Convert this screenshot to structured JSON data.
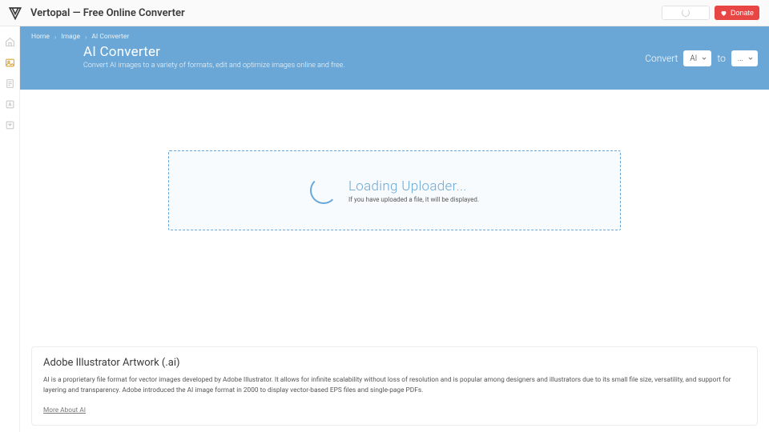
{
  "header": {
    "title": "Vertopal — Free Online Converter",
    "donate_label": "Donate"
  },
  "sidebar": {
    "items": [
      {
        "name": "home"
      },
      {
        "name": "image",
        "active": true
      },
      {
        "name": "document"
      },
      {
        "name": "font"
      },
      {
        "name": "ebook"
      }
    ]
  },
  "breadcrumb": {
    "items": [
      "Home",
      "Image",
      "AI Converter"
    ]
  },
  "hero": {
    "title": "AI Converter",
    "subtitle": "Convert AI images to a variety of formats, edit and optimize images online and free."
  },
  "convert_bar": {
    "label_convert": "Convert",
    "from_value": "AI",
    "label_to": "to",
    "to_value": "..."
  },
  "uploader": {
    "title": "Loading Uploader...",
    "subtitle": "If you have uploaded a file, it will be displayed."
  },
  "info": {
    "heading": "Adobe Illustrator Artwork (.ai)",
    "body": "AI is a proprietary file format for vector images developed by Adobe Illustrator. It allows for infinite scalability without loss of resolution and is popular among designers and illustrators due to its small file size, versatility, and support for layering and transparency. Adobe introduced the AI image format in 2000 to display vector-based EPS files and single-page PDFs.",
    "more_link": "More About AI"
  }
}
